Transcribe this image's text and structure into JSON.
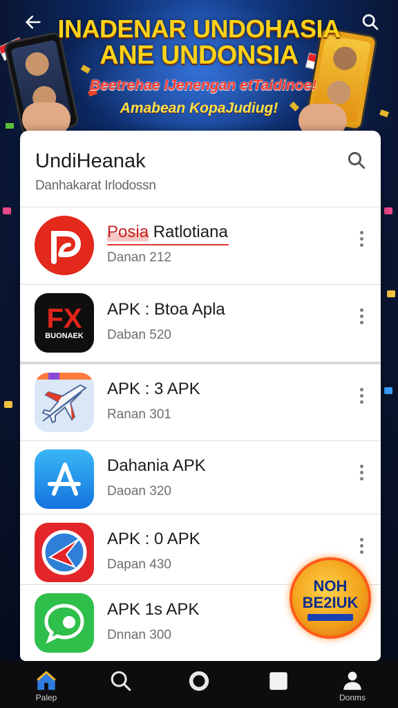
{
  "banner": {
    "title_line1": "INADENAR UNDOHASIA",
    "title_line2": "ANE UNDONSIA",
    "subtitle_line1": "Beetrehae IJenengan etTaidinoe!",
    "subtitle_line2": "Amabean KopaJudiug!"
  },
  "card": {
    "title": "UndiHeanak",
    "subtitle": "Danhakarat Irlodossn"
  },
  "apps": [
    {
      "name_highlight": "Posia",
      "name": " Ratlotiana",
      "meta": "Danan 212",
      "icon": "p-logo-icon"
    },
    {
      "name": "APK : Btoa Apla",
      "meta": "Daban 520",
      "icon": "fx-logo-icon",
      "icon_caption": "BUONAEK"
    },
    {
      "name": "APK : 3 APK",
      "meta": "Ranan 301",
      "icon": "airplane-icon"
    },
    {
      "name": "Dahania APK",
      "meta": "Daoan 320",
      "icon": "app-store-a-icon"
    },
    {
      "name": "APK : 0 APK",
      "meta": "Dapan 430",
      "icon": "compass-icon"
    },
    {
      "name": "APK 1s APK",
      "meta": "Dnnan 300",
      "icon": "chat-bubble-icon"
    }
  ],
  "badge": {
    "line1": "NOH",
    "line2": "BE2IUK"
  },
  "bottom_nav": [
    {
      "label": "Palep",
      "icon": "home-icon"
    },
    {
      "label": "",
      "icon": "search-icon"
    },
    {
      "label": "",
      "icon": "circle-icon"
    },
    {
      "label": "",
      "icon": "square-icon"
    },
    {
      "label": "Donms",
      "icon": "person-icon"
    }
  ],
  "colors": {
    "banner_title": "#ffd21a",
    "banner_sub_red": "#ff3b2f",
    "card_bg": "#ffffff",
    "nav_bg": "#0d0d10"
  }
}
